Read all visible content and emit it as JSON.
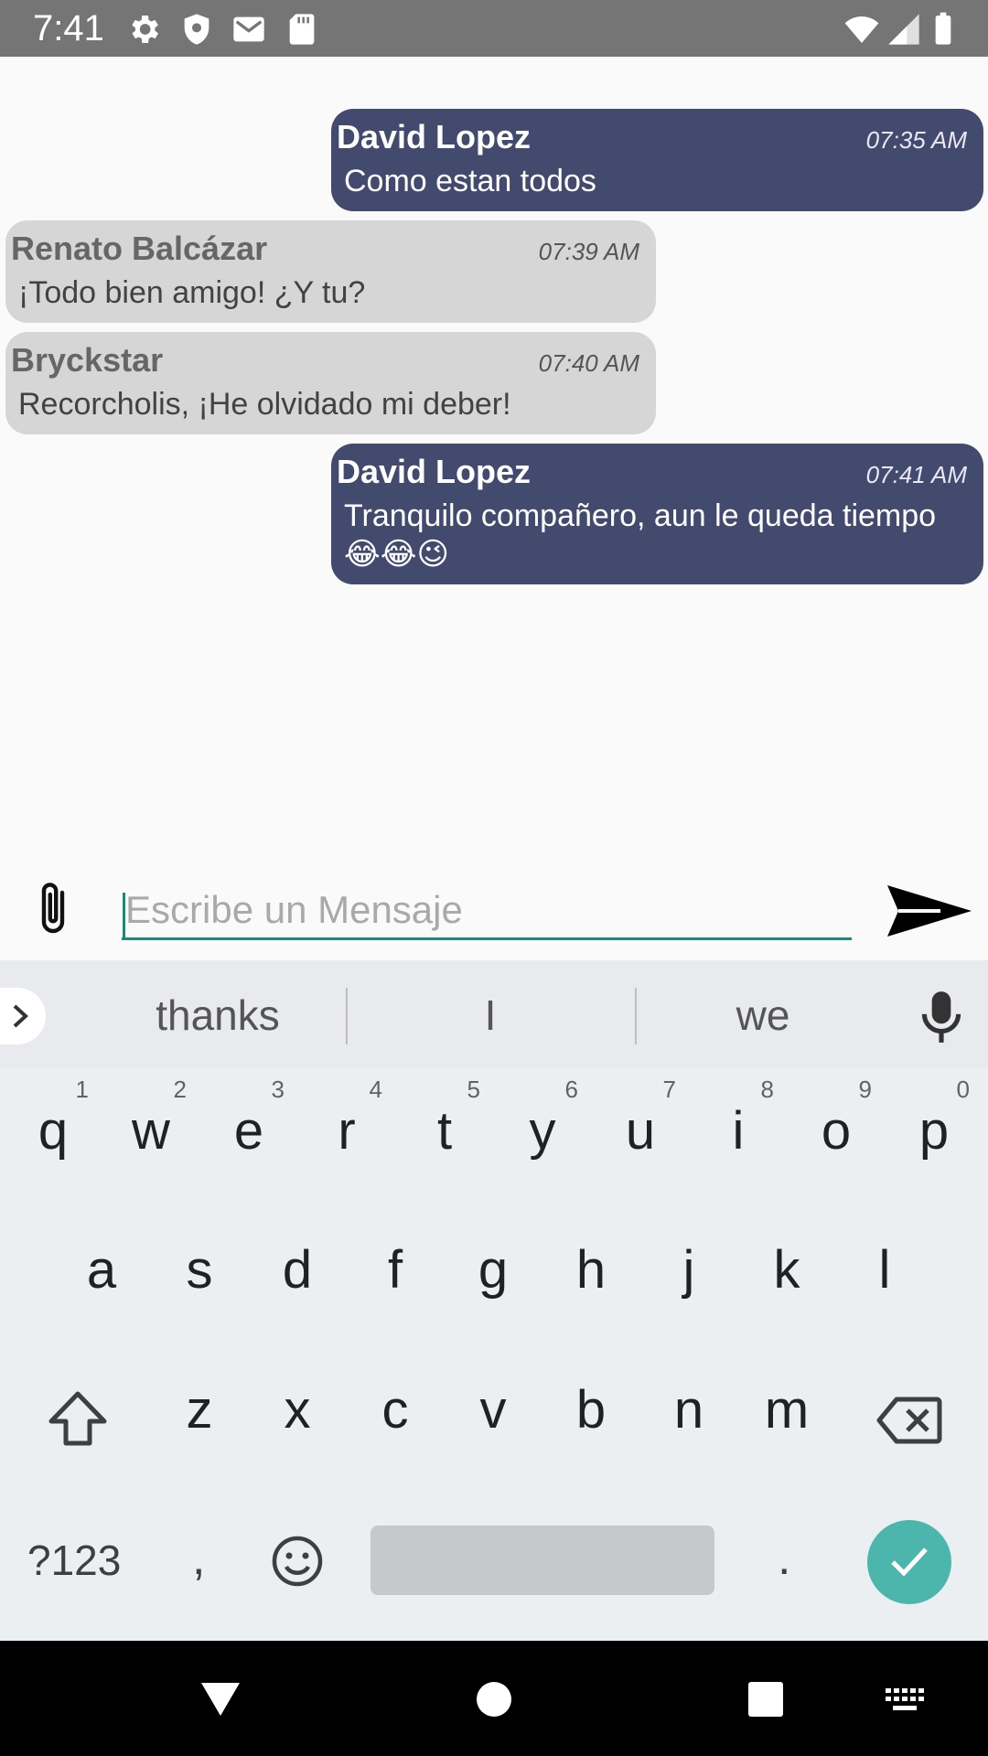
{
  "status_bar": {
    "time": "7:41",
    "icons": [
      "gear-icon",
      "shield-icon",
      "gmail-icon",
      "sd-card-icon",
      "wifi-icon",
      "signal-icon",
      "battery-icon"
    ]
  },
  "messages": [
    {
      "direction": "outgoing",
      "sender": "David Lopez",
      "time": "07:35 AM",
      "text": "Como estan todos"
    },
    {
      "direction": "incoming",
      "sender": "Renato Balcázar",
      "time": "07:39 AM",
      "text": "¡Todo bien amigo! ¿Y tu?"
    },
    {
      "direction": "incoming",
      "sender": "Bryckstar",
      "time": "07:40 AM",
      "text": "Recorcholis, ¡He olvidado mi deber!"
    },
    {
      "direction": "outgoing",
      "sender": "David Lopez",
      "time": "07:41 AM",
      "text": "Tranquilo compañero, aun le queda tiempo 😂😂😉"
    }
  ],
  "composer": {
    "placeholder": "Escribe un Mensaje",
    "value": ""
  },
  "keyboard": {
    "suggestions": [
      "thanks",
      "I",
      "we"
    ],
    "row1": [
      "q",
      "w",
      "e",
      "r",
      "t",
      "y",
      "u",
      "i",
      "o",
      "p"
    ],
    "row1_hints": [
      "1",
      "2",
      "3",
      "4",
      "5",
      "6",
      "7",
      "8",
      "9",
      "0"
    ],
    "row2": [
      "a",
      "s",
      "d",
      "f",
      "g",
      "h",
      "j",
      "k",
      "l"
    ],
    "row3": [
      "z",
      "x",
      "c",
      "v",
      "b",
      "n",
      "m"
    ],
    "symbols_label": "?123",
    "comma": ",",
    "period": "."
  },
  "colors": {
    "outgoing_bubble": "#424a6e",
    "incoming_bubble": "#d7d6d6",
    "accent": "#1b8a7e",
    "enter_button": "#4db6ac"
  }
}
